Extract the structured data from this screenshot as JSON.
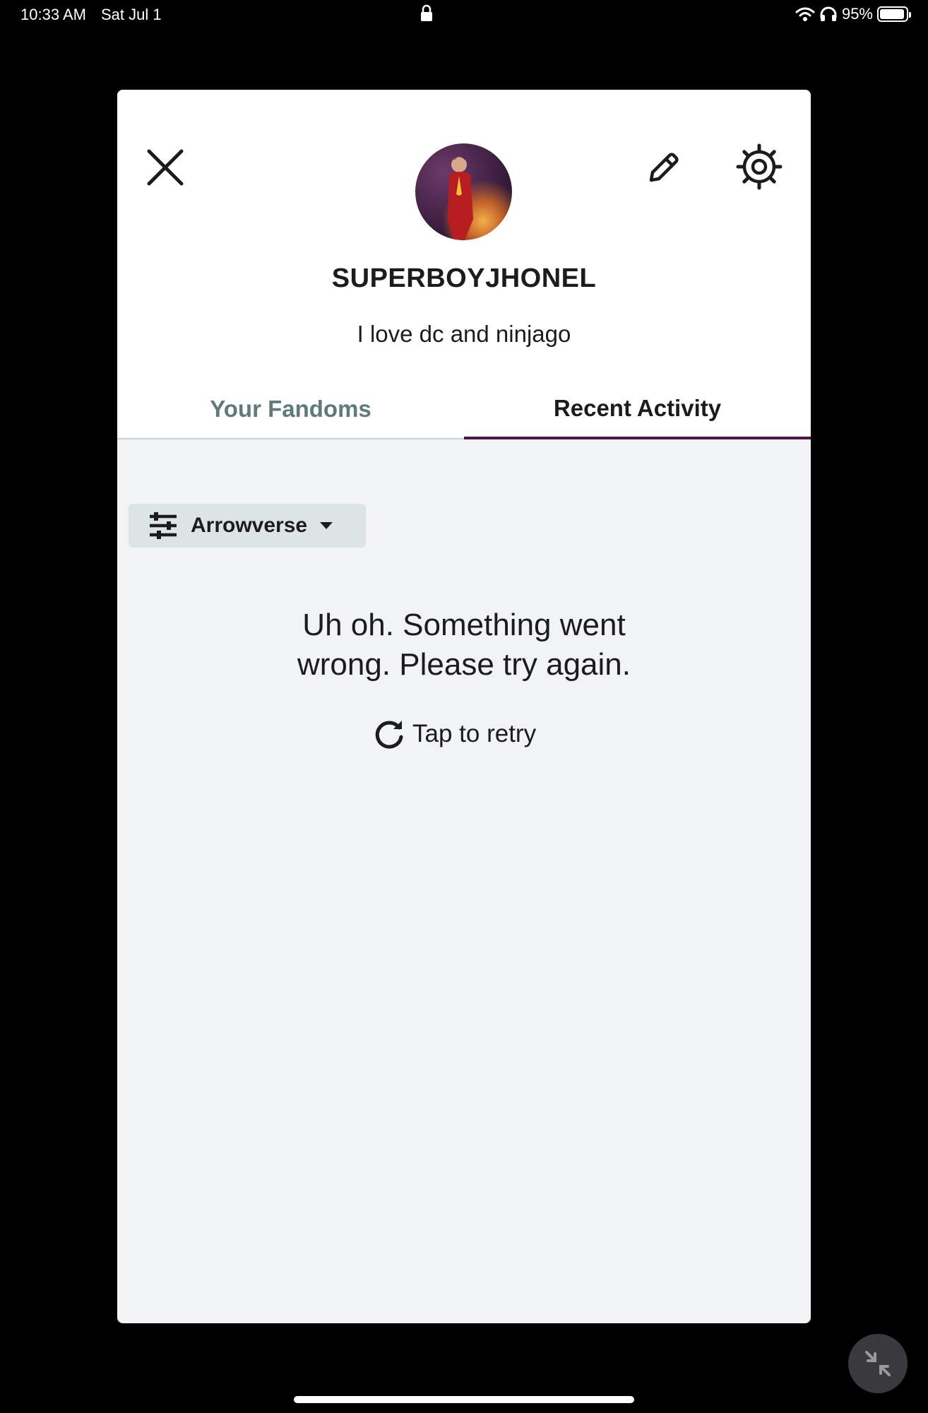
{
  "status_bar": {
    "time": "10:33 AM",
    "date": "Sat Jul 1",
    "battery_percent": "95%",
    "battery_level": 0.95,
    "icons": [
      "lock-icon",
      "wifi-icon",
      "headphones-icon",
      "battery-icon"
    ]
  },
  "profile": {
    "username": "SUPERBOYJHONEL",
    "bio": "I love dc and ninjago"
  },
  "tabs": [
    {
      "label": "Your Fandoms",
      "active": false
    },
    {
      "label": "Recent Activity",
      "active": true
    }
  ],
  "filter": {
    "selected": "Arrowverse"
  },
  "error": {
    "message": "Uh oh. Something went wrong. Please try again.",
    "line1": "Uh oh. Something went",
    "line2": "wrong. Please try again.",
    "retry_label": "Tap to retry"
  },
  "colors": {
    "active_tab_underline": "#4b1548",
    "inactive_tab_text": "#5f7a7a",
    "chip_background": "#dde5e4",
    "content_background": "#f2f3f5"
  }
}
